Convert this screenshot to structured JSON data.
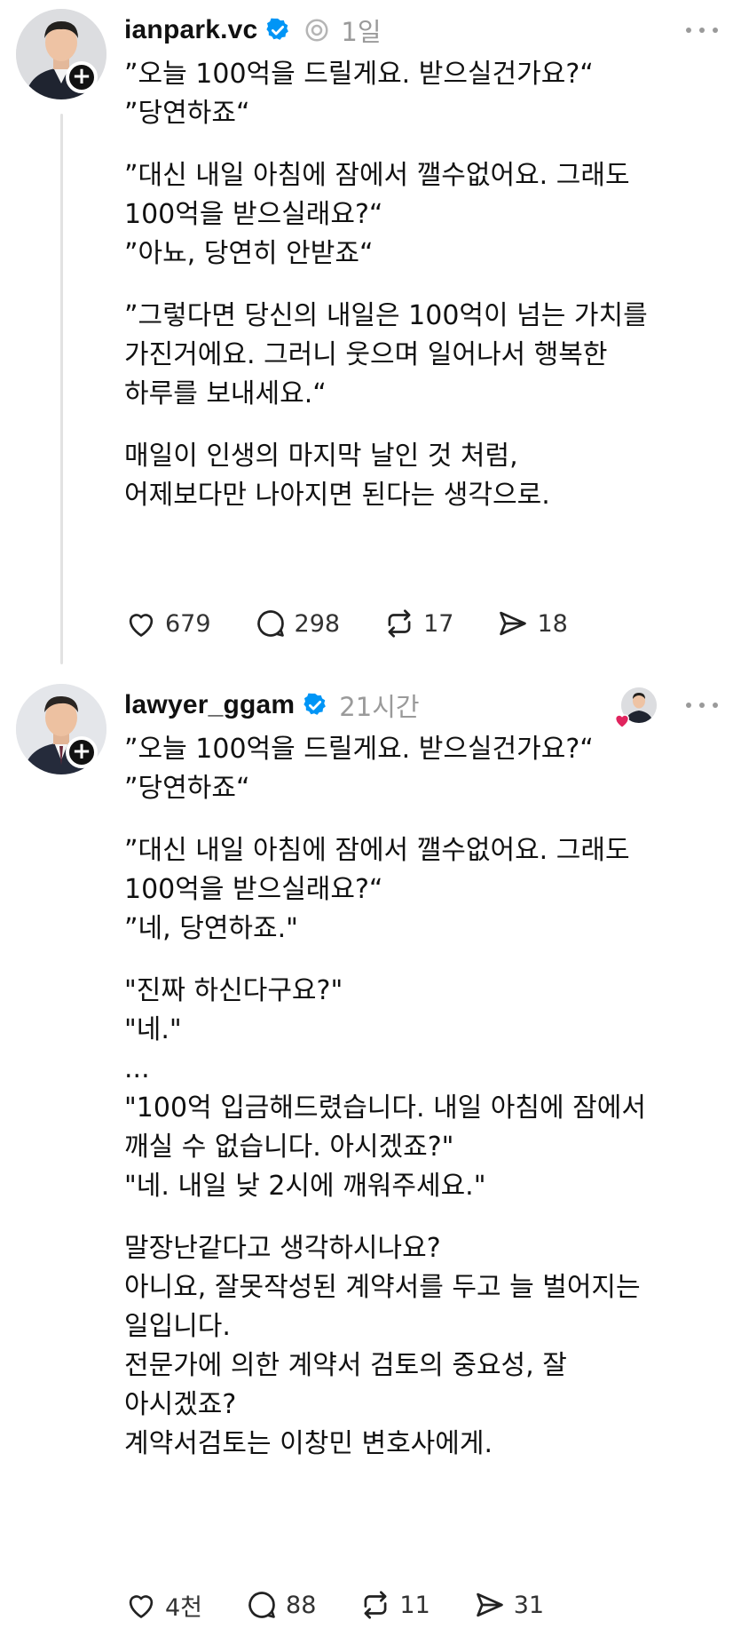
{
  "posts": [
    {
      "username": "ianpark.vc",
      "timestamp": "1일",
      "paragraphs": [
        "”오늘 100억을 드릴게요. 받으실건가요?“\n”당연하죠“",
        "”대신 내일 아침에 잠에서 깰수없어요. 그래도\n100억을 받으실래요?“\n”아뇨, 당연히 안받죠“",
        "”그렇다면 당신의 내일은 100억이 넘는 가치를\n가진거에요. 그러니 웃으며 일어나서 행복한\n하루를 보내세요.“",
        "매일이 인생의 마지막 날인 것 처럼,\n어제보다만 나아지면 된다는 생각으로."
      ],
      "likes": "679",
      "comments": "298",
      "reposts": "17",
      "shares": "18"
    },
    {
      "username": "lawyer_ggam",
      "timestamp": "21시간",
      "paragraphs": [
        "”오늘 100억을 드릴게요. 받으실건가요?“\n”당연하죠“",
        "”대신 내일 아침에 잠에서 깰수없어요. 그래도\n100억을 받으실래요?“\n”네, 당연하죠.\"",
        "\"진짜 하신다구요?\"\n\"네.\"\n...\n\"100억 입금해드렸습니다. 내일 아침에 잠에서\n깨실 수 없습니다. 아시겠죠?\"\n\"네. 내일 낮 2시에 깨워주세요.\"",
        "말장난같다고 생각하시나요?\n아니요, 잘못작성된 계약서를 두고 늘 벌어지는\n일입니다.\n전문가에 의한 계약서 검토의 중요성, 잘\n아시겠죠?\n계약서검토는 이창민 변호사에게."
      ],
      "likes": "4천",
      "comments": "88",
      "reposts": "11",
      "shares": "31"
    }
  ],
  "icons": {
    "follow": "plus-icon",
    "verified": "verified-badge-icon",
    "threads": "threads-logo-icon",
    "more": "more-horizontal-icon",
    "like": "heart-icon",
    "comment": "comment-icon",
    "repost": "repost-icon",
    "share": "send-icon",
    "liked_by": "red-heart-icon"
  },
  "colors": {
    "verified": "#0095f6",
    "secondary_text": "#9a9a9a",
    "heart_badge": "#e0245e"
  }
}
